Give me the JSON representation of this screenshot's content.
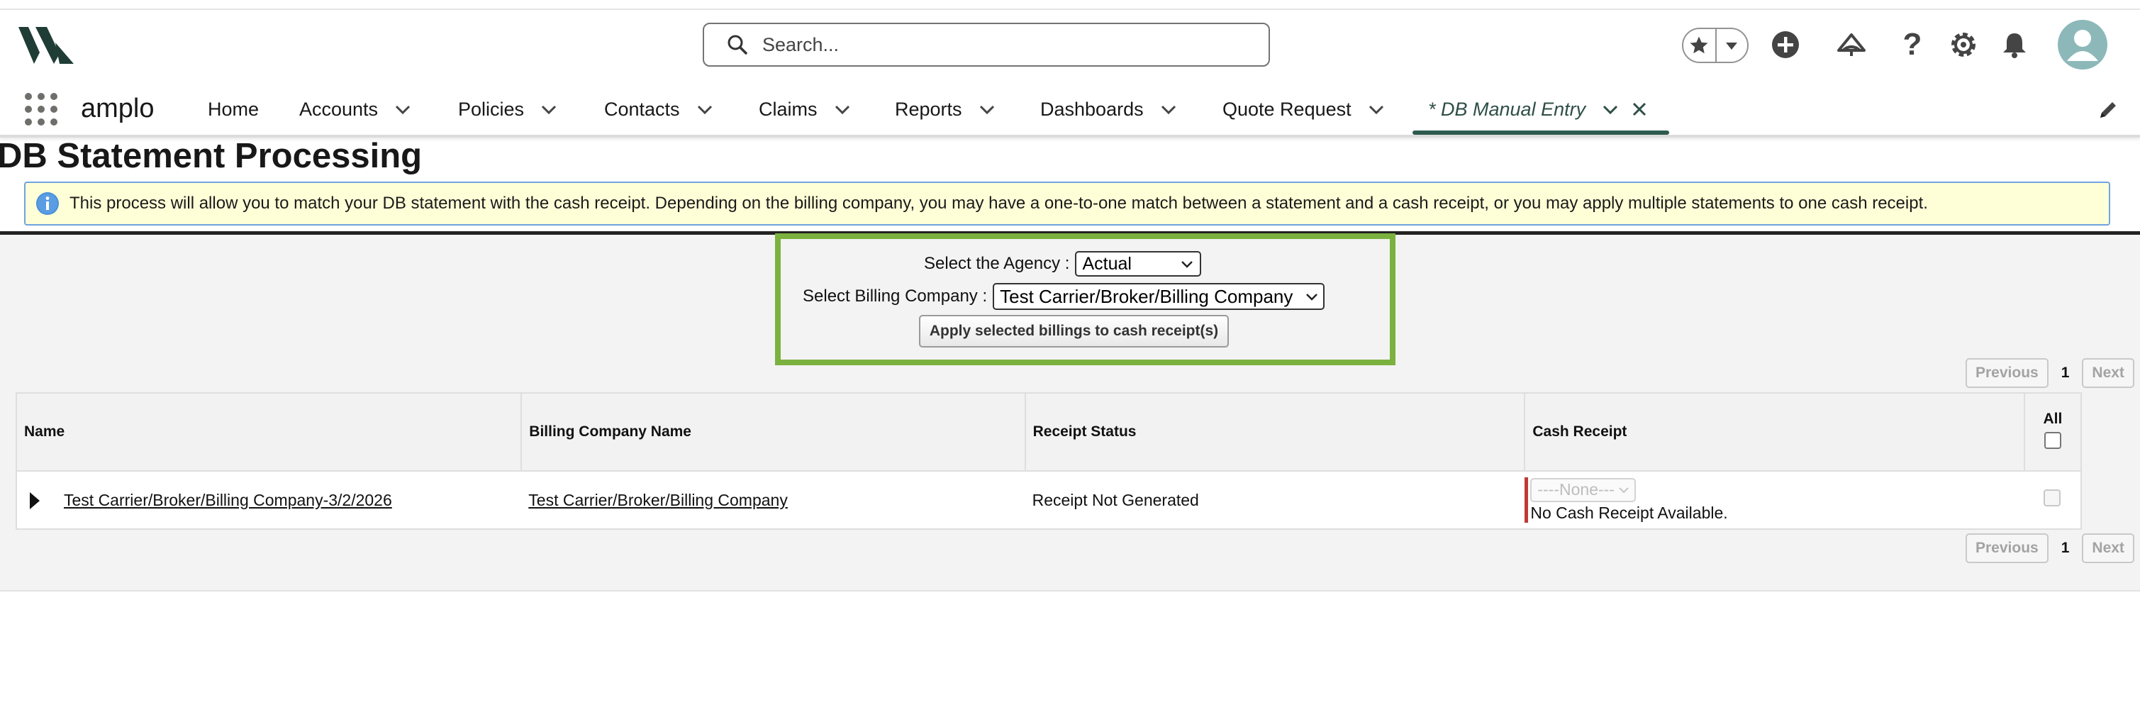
{
  "header": {
    "search_placeholder": "Search..."
  },
  "nav": {
    "app_name": "amplo",
    "items": [
      {
        "label": "Home"
      },
      {
        "label": "Accounts"
      },
      {
        "label": "Policies"
      },
      {
        "label": "Contacts"
      },
      {
        "label": "Claims"
      },
      {
        "label": "Reports"
      },
      {
        "label": "Dashboards"
      },
      {
        "label": "Quote Request"
      }
    ],
    "active_tab": {
      "label": "* DB Manual Entry"
    }
  },
  "page": {
    "title": "DB Statement Processing",
    "info_text": "This process will allow you to match your DB statement with the cash receipt. Depending on the billing company, you may have a one-to-one match between a statement and a cash receipt, or you may apply multiple statements to one cash receipt."
  },
  "selectors": {
    "agency_label": "Select the Agency :",
    "agency_value": "Actual",
    "billing_label": "Select Billing Company :",
    "billing_value": "Test Carrier/Broker/Billing Company",
    "apply_button": "Apply selected billings to cash receipt(s)"
  },
  "pager": {
    "previous": "Previous",
    "page": "1",
    "next": "Next"
  },
  "table": {
    "columns": [
      "Name",
      "Billing Company Name",
      "Receipt Status",
      "Cash Receipt",
      "All"
    ],
    "rows": [
      {
        "name": "Test Carrier/Broker/Billing Company-3/2/2026",
        "billing_company": "Test Carrier/Broker/Billing Company",
        "receipt_status": "Receipt Not Generated",
        "cash_receipt_select": "----None---",
        "cash_receipt_note": "No Cash Receipt Available."
      }
    ]
  },
  "colors": {
    "brand_dark": "#1f3d34",
    "highlight_border": "#7bb13f",
    "banner_bg": "#ffffd7",
    "required_bar": "#c23934"
  }
}
